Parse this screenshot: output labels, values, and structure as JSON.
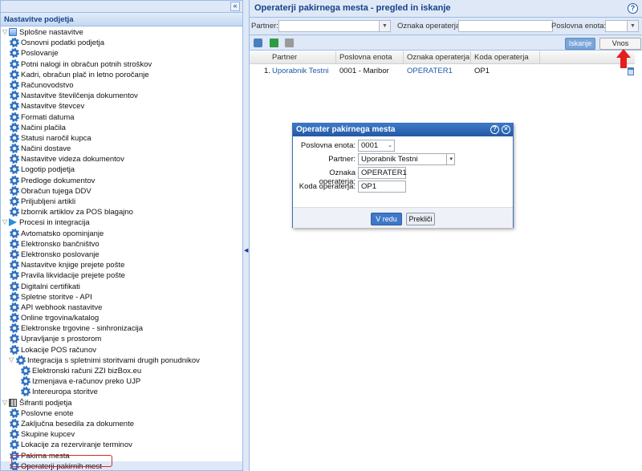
{
  "sidebar": {
    "title": "Nastavitve podjetja",
    "collapse_glyph": "«",
    "groups": [
      {
        "label": "Splošne nastavitve",
        "icon": "folder-icon",
        "items": [
          "Osnovni podatki podjetja",
          "Poslovanje",
          "Potni nalogi in obračun potnih stroškov",
          "Kadri, obračun plač in letno poročanje",
          "Računovodstvo",
          "Nastavitve številčenja dokumentov",
          "Nastavitve števcev",
          "Formati datuma",
          "Načini plačila",
          "Statusi naročil kupca",
          "Načini dostave",
          "Nastavitve videza dokumentov",
          "Logotip podjetja",
          "Predloge dokumentov",
          "Obračun tujega DDV",
          "Priljubljeni artikli",
          "Izbornik artiklov za POS blagajno"
        ]
      },
      {
        "label": "Procesi in integracija",
        "icon": "process-arrow-icon",
        "items": [
          "Avtomatsko opominjanje",
          "Elektronsko bančništvo",
          "Elektronsko poslovanje",
          "Nastavitve knjige prejete pošte",
          "Pravila likvidacije prejete pošte",
          "Digitalni certifikati",
          "Spletne storitve - API",
          "API webhook nastavitve",
          "Online trgovina/katalog",
          "Elektronske trgovine - sinhronizacija",
          "Upravljanje s prostorom",
          "Lokacije POS računov",
          "Integracija s spletnimi storitvami drugih ponudnikov"
        ],
        "subitems": [
          "Elektronski računi ZZI bizBox.eu",
          "Izmenjava e-računov preko UJP",
          "Intereuropa storitve"
        ]
      },
      {
        "label": "Šifranti podjetja",
        "icon": "book-icon",
        "items": [
          "Poslovne enote",
          "Zaključna besedila za dokumente",
          "Skupine kupcev",
          "Lokacije za rezerviranje terminov",
          "Pakirna mesta",
          "Operaterji pakirnih mest"
        ]
      }
    ]
  },
  "main": {
    "title": "Operaterji pakirnega mesta - pregled in iskanje",
    "help_glyph": "?",
    "filters": {
      "partner_label": "Partner:",
      "operator_label": "Oznaka operaterja:",
      "unit_label": "Poslovna enota:"
    },
    "toolbar": {
      "search_label": "Iskanje",
      "new_label": "Vnos novega"
    },
    "columns": [
      "Partner",
      "Poslovna enota",
      "Oznaka operaterja",
      "Koda operaterja"
    ],
    "rows": [
      {
        "num": "1.",
        "partner": "Uporabnik Testni",
        "unit": "0001 - Maribor",
        "operator_mark": "OPERATER1",
        "operator_code": "OP1"
      }
    ]
  },
  "dialog": {
    "title": "Operater pakirnega mesta",
    "help_glyph": "?",
    "close_glyph": "×",
    "unit_label": "Poslovna enota:",
    "unit_value": "0001",
    "partner_label": "Partner:",
    "partner_value": "Uporabnik Testni",
    "operator_mark_label": "Oznaka operaterja:",
    "operator_mark_value": "OPERATER1",
    "operator_code_label": "Koda operaterja:",
    "operator_code_value": "OP1",
    "ok_label": "V redu",
    "cancel_label": "Prekliči"
  },
  "colors": {
    "header_blue": "#15428b",
    "panel_bg": "#dfe8f6",
    "highlight_red": "#e51d1d"
  }
}
